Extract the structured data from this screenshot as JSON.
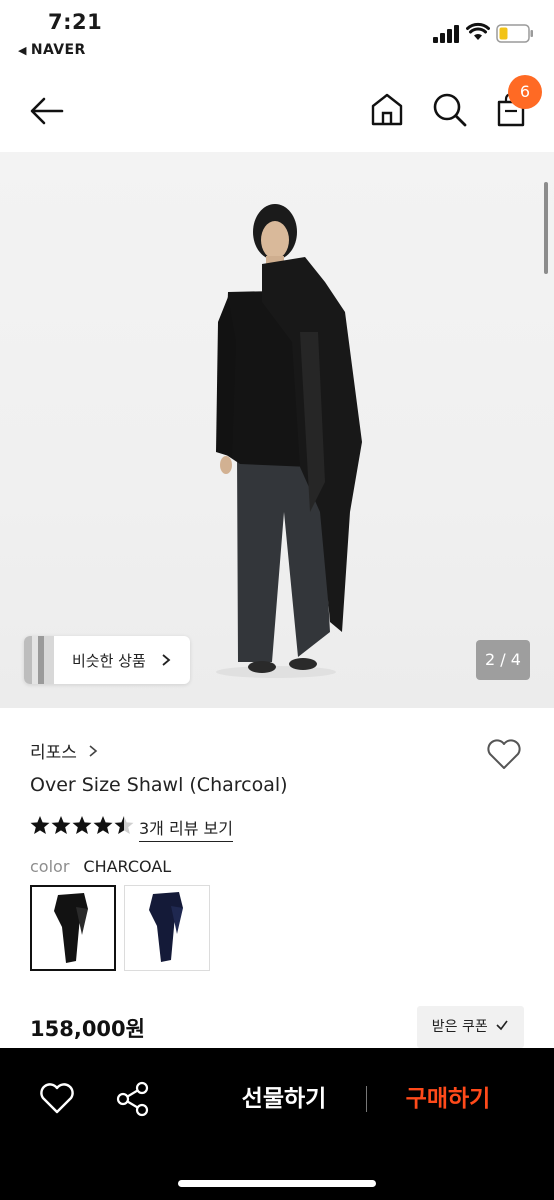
{
  "status_bar": {
    "time": "7:21",
    "back_app": "NAVER",
    "back_arrow_icon": "triangle-left-icon"
  },
  "header": {
    "icons": [
      "back-arrow-icon",
      "home-icon",
      "search-icon",
      "shopping-bag-icon"
    ],
    "cart_count": "6",
    "accent_color": "#ff6a24"
  },
  "gallery": {
    "similar_label": "비슷한 상품",
    "page_indicator": "2 / 4"
  },
  "product": {
    "brand": "리포스",
    "name": "Over Size Shawl (Charcoal)",
    "rating_stars": 4.5,
    "rating_max": 5,
    "review_link": "3개 리뷰 보기",
    "color_label": "color",
    "color_value": "CHARCOAL",
    "swatches": [
      "black",
      "navy"
    ],
    "price": "158,000원",
    "coupon_label": "받은 쿠폰"
  },
  "bottom_bar": {
    "gift_label": "선물하기",
    "buy_label": "구매하기",
    "buy_color": "#ff4a1a"
  }
}
